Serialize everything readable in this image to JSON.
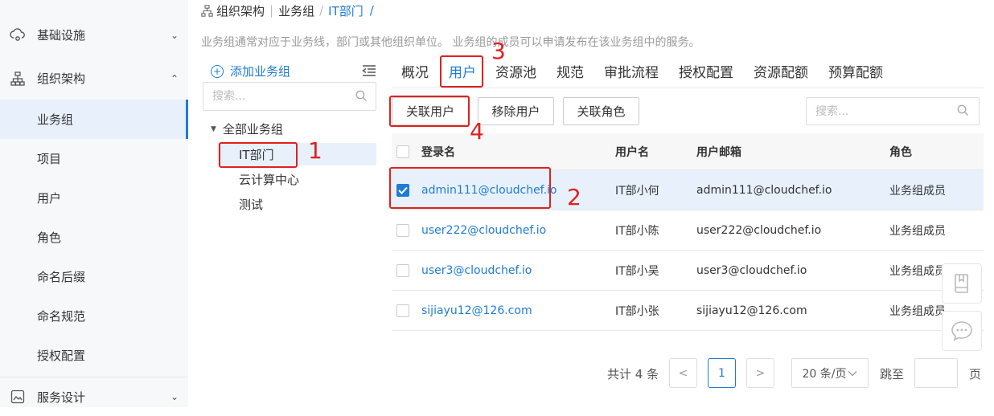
{
  "sidebar": {
    "items": [
      {
        "label": "基础设施",
        "icon": "cloud-gear-icon",
        "chevron": "⌄"
      },
      {
        "label": "组织架构",
        "icon": "org-tree-icon",
        "chevron": "⌃"
      },
      {
        "label": "业务组"
      },
      {
        "label": "项目"
      },
      {
        "label": "用户"
      },
      {
        "label": "角色"
      },
      {
        "label": "命名后缀"
      },
      {
        "label": "命名规范"
      },
      {
        "label": "授权配置"
      },
      {
        "label": "服务设计",
        "icon": "service-design-icon",
        "chevron": "⌄"
      }
    ]
  },
  "breadcrumb": {
    "items": [
      "组织架构",
      "业务组",
      "IT部门",
      "/"
    ]
  },
  "description": "业务组通常对应于业务线，部门或其他组织单位。 业务组的成员可以申请发布在该业务组中的服务。",
  "tree": {
    "add_label": "添加业务组",
    "search_placeholder": "搜索...",
    "root_label": "全部业务组",
    "nodes": [
      "IT部门",
      "云计算中心",
      "测试"
    ]
  },
  "tabs": [
    "概况",
    "用户",
    "资源池",
    "规范",
    "审批流程",
    "授权配置",
    "资源配额",
    "预算配额"
  ],
  "toolbar": {
    "associate_user": "关联用户",
    "remove_user": "移除用户",
    "associate_role": "关联角色",
    "search_placeholder": "搜索..."
  },
  "table": {
    "columns": [
      "登录名",
      "用户名",
      "用户邮箱",
      "角色"
    ],
    "rows": [
      {
        "login": "admin111@cloudchef.io",
        "name": "IT部小何",
        "email": "admin111@cloudchef.io",
        "role": "业务组成员",
        "checked": true
      },
      {
        "login": "user222@cloudchef.io",
        "name": "IT部小陈",
        "email": "user222@cloudchef.io",
        "role": "业务组成员",
        "checked": false
      },
      {
        "login": "user3@cloudchef.io",
        "name": "IT部小吴",
        "email": "user3@cloudchef.io",
        "role": "业务组成员",
        "checked": false
      },
      {
        "login": "sijiayu12@126.com",
        "name": "IT部小张",
        "email": "sijiayu12@126.com",
        "role": "业务组成员",
        "checked": false
      }
    ]
  },
  "pagination": {
    "total": "共计 4 条",
    "prev": "<",
    "current": "1",
    "next": ">",
    "page_size": "20 条/页",
    "jump_label": "跳至",
    "page_label": "页"
  },
  "annotations": [
    "1",
    "2",
    "3",
    "4"
  ],
  "colors": {
    "accent": "#1f7cd3",
    "annotation": "#e02020"
  }
}
